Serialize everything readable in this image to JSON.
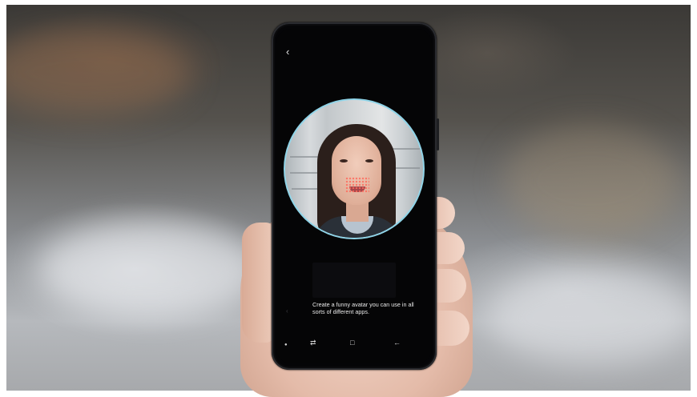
{
  "screen": {
    "caption": "Create a funny avatar you can use in all sorts of different apps.",
    "icons": {
      "back": "back-arrow-icon",
      "recent_apps": "recent-apps-icon",
      "home": "home-icon",
      "back_nav": "back-nav-icon"
    }
  },
  "colors": {
    "camera_ring": "#8fd4e8",
    "screen_background": "#050506",
    "caption_text": "#e9e9e9"
  }
}
